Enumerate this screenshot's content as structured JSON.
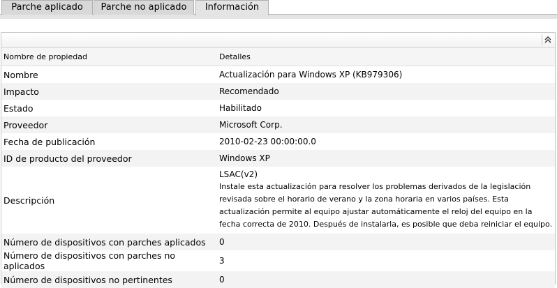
{
  "tabs": [
    {
      "label": "Parche aplicado",
      "active": false
    },
    {
      "label": "Parche no aplicado",
      "active": false
    },
    {
      "label": "Información",
      "active": true
    }
  ],
  "panel": {
    "collapse_icon": "double-chevron-up-icon"
  },
  "table": {
    "headers": [
      "Nombre de propiedad",
      "Detalles"
    ],
    "rows": [
      {
        "name": "Nombre",
        "value": "Actualización para Windows XP (KB979306)"
      },
      {
        "name": "Impacto",
        "value": "Recomendado"
      },
      {
        "name": "Estado",
        "value": "Habilitado"
      },
      {
        "name": "Proveedor",
        "value": "Microsoft Corp."
      },
      {
        "name": "Fecha de publicación",
        "value": "2010-02-23 00:00:00.0"
      },
      {
        "name": "ID de producto del proveedor",
        "value": "Windows XP"
      },
      {
        "name": "Descripción",
        "value_title": "LSAC(v2)",
        "value_lines": [
          "Instale esta actualización para resolver los problemas derivados de la legislación",
          "revisada sobre el horario de verano y la zona horaria en varios países. Esta",
          "actualización permite al equipo ajustar automáticamente el reloj del equipo en la",
          "fecha correcta de 2010. Después de instalarla, es posible que deba reiniciar el equipo."
        ]
      },
      {
        "name": "Número de dispositivos con parches aplicados",
        "value": "0"
      },
      {
        "name": "Número de dispositivos con parches no aplicados",
        "value": "3"
      },
      {
        "name": "Número de dispositivos no pertinentes",
        "value": "0"
      }
    ]
  }
}
